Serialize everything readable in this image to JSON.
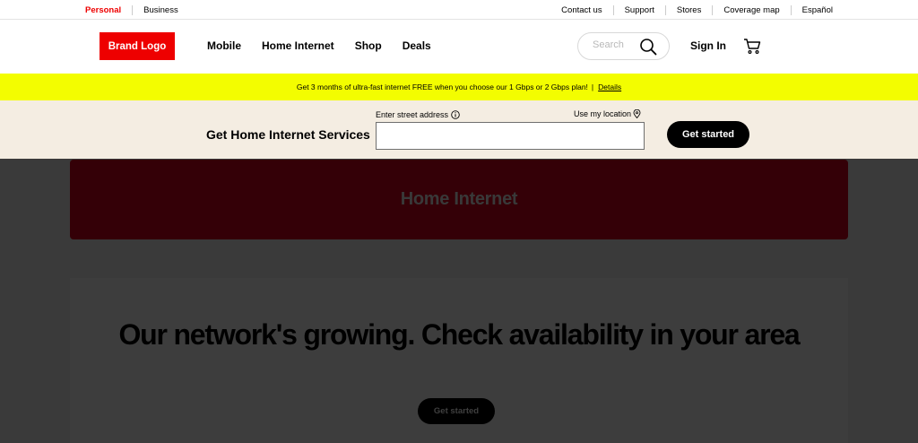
{
  "utility_bar": {
    "left": [
      "Personal",
      "Business"
    ],
    "right": [
      "Contact us",
      "Support",
      "Stores",
      "Coverage map",
      "Español"
    ]
  },
  "header": {
    "logo": "Brand Logo",
    "nav": [
      "Mobile",
      "Home Internet",
      "Shop",
      "Deals"
    ],
    "search_placeholder": "Search",
    "sign_in": "Sign In",
    "icons": [
      "search-icon",
      "cart-icon"
    ]
  },
  "promo": {
    "text": "Get 3 months of ultra-fast internet FREE when you choose our 1 Gbps or 2 Gbps plan!",
    "separator": "|",
    "link": "Details"
  },
  "address": {
    "title": "Get Home Internet Services",
    "label": "Enter street address",
    "location_link": "Use my location",
    "input_value": "",
    "cta": "Get started",
    "icons": [
      "info-icon",
      "location-pin-icon"
    ]
  },
  "hero": {
    "title": "Home Internet"
  },
  "availability": {
    "headline": "Our network's growing. Check availability in your area",
    "cta": "Get started"
  },
  "colors": {
    "brand_red": "#ee0000",
    "promo_yellow": "#f3fd00",
    "address_band": "#f4ede2",
    "overlay_dim": "#3a3a3a"
  }
}
